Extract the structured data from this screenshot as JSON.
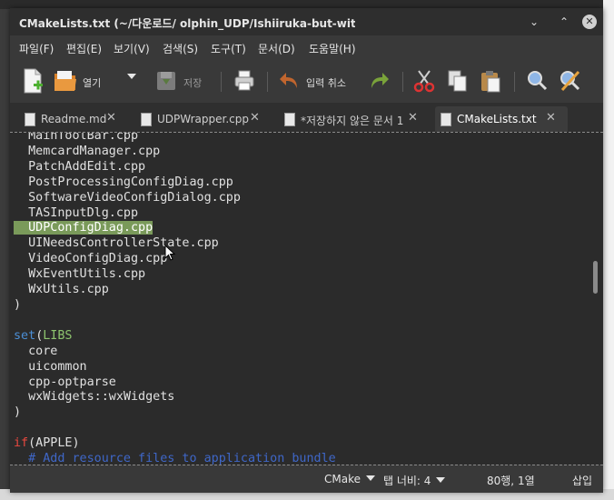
{
  "window": {
    "title": "CMakeLists.txt (~/다운로드/  olphin_UDP/Ishiiruka-but-with-UDPN"
  },
  "menubar": {
    "items": [
      "파일(F)",
      "편집(E)",
      "보기(V)",
      "검색(S)",
      "도구(T)",
      "문서(D)",
      "도움말(H)"
    ]
  },
  "toolbar": {
    "open_label": "열기",
    "save_label": "저장",
    "undo_label": "입력 취소"
  },
  "tabs": [
    {
      "label": "Readme.md"
    },
    {
      "label": "UDPWrapper.cpp"
    },
    {
      "label": "*저장하지 않은 문서 1"
    },
    {
      "label": "CMakeLists.txt"
    }
  ],
  "editor": {
    "lines": [
      "MainToolBar.cpp",
      "MemcardManager.cpp",
      "PatchAddEdit.cpp",
      "PostProcessingConfigDiag.cpp",
      "SoftwareVideoConfigDialog.cpp",
      "TASInputDlg.cpp",
      "UDPConfigDiag.cpp",
      "UINeedsControllerState.cpp",
      "VideoConfigDiag.cpp",
      "WxEventUtils.cpp",
      "WxUtils.cpp",
      ")",
      "",
      "set(LIBS",
      "core",
      "uicommon",
      "cpp-optparse",
      "wxWidgets::wxWidgets",
      ")",
      "",
      "if(APPLE)",
      "# Add resource files to application bundle"
    ],
    "highlighted_line": "UDPConfigDiag.cpp"
  },
  "statusbar": {
    "language": "CMake",
    "tab_width": "탭 너비: 4",
    "position": "80행, 1열",
    "mode": "삽입"
  },
  "colors": {
    "keyword_set": "#4b8fd6",
    "keyword_if": "#e8483f",
    "variable": "#8ec46e",
    "comment": "#3f67c8",
    "selection": "#7a9a5a"
  }
}
